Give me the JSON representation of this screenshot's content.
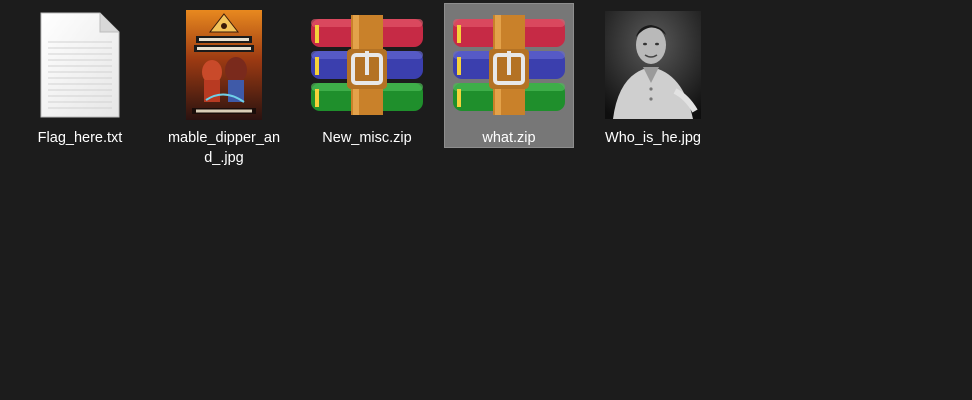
{
  "files": [
    {
      "name": "Flag_here.txt",
      "icon": "text-file-icon",
      "selected": false
    },
    {
      "name": "mable_dipper_and_.jpg",
      "icon": "image-thumbnail-icon",
      "selected": false
    },
    {
      "name": "New_misc.zip",
      "icon": "winrar-archive-icon",
      "selected": false
    },
    {
      "name": "what.zip",
      "icon": "winrar-archive-icon",
      "selected": true
    },
    {
      "name": "Who_is_he.jpg",
      "icon": "photo-thumbnail-icon",
      "selected": false
    }
  ],
  "colors": {
    "background": "#1c1c1c",
    "selection": "#777777",
    "text": "#ffffff"
  }
}
